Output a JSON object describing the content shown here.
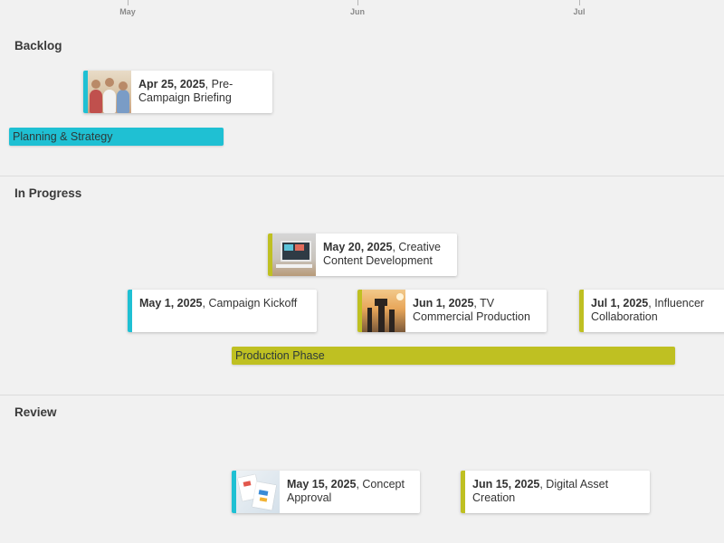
{
  "timeline": {
    "months": [
      {
        "label": "May"
      },
      {
        "label": "Jun"
      },
      {
        "label": "Jul"
      }
    ]
  },
  "colors": {
    "teal": "#1fc0d3",
    "olive": "#bfc022",
    "card_bg": "#ffffff",
    "background": "#f1f1f1"
  },
  "lanes": [
    {
      "title": "Backlog",
      "items": [
        {
          "date": "Apr 25, 2025",
          "name": ", Pre-Campaign Briefing",
          "has_thumbnail": true,
          "thumbnail_icon": "meeting-people-photo",
          "color": "teal"
        }
      ],
      "bars": [
        {
          "label": "Planning & Strategy",
          "color": "teal"
        }
      ]
    },
    {
      "title": "In Progress",
      "items": [
        {
          "date": "May 20, 2025",
          "name": ", Creative Content Development",
          "has_thumbnail": true,
          "thumbnail_icon": "computer-screen-photo",
          "color": "olive"
        },
        {
          "date": "May 1, 2025",
          "name": ", Campaign Kickoff",
          "has_thumbnail": false,
          "color": "teal"
        },
        {
          "date": "Jun 1, 2025",
          "name": ", TV Commercial Production",
          "has_thumbnail": true,
          "thumbnail_icon": "film-crew-photo",
          "color": "olive"
        },
        {
          "date": "Jul 1, 2025",
          "name": ", Influencer Collaboration",
          "has_thumbnail": false,
          "color": "olive"
        }
      ],
      "bars": [
        {
          "label": "Production Phase",
          "color": "olive"
        }
      ]
    },
    {
      "title": "Review",
      "items": [
        {
          "date": "May 15, 2025",
          "name": ", Concept Approval",
          "has_thumbnail": true,
          "thumbnail_icon": "documents-photo",
          "color": "teal"
        },
        {
          "date": "Jun 15, 2025",
          "name": ", Digital Asset Creation",
          "has_thumbnail": false,
          "color": "olive"
        }
      ],
      "bars": []
    }
  ]
}
